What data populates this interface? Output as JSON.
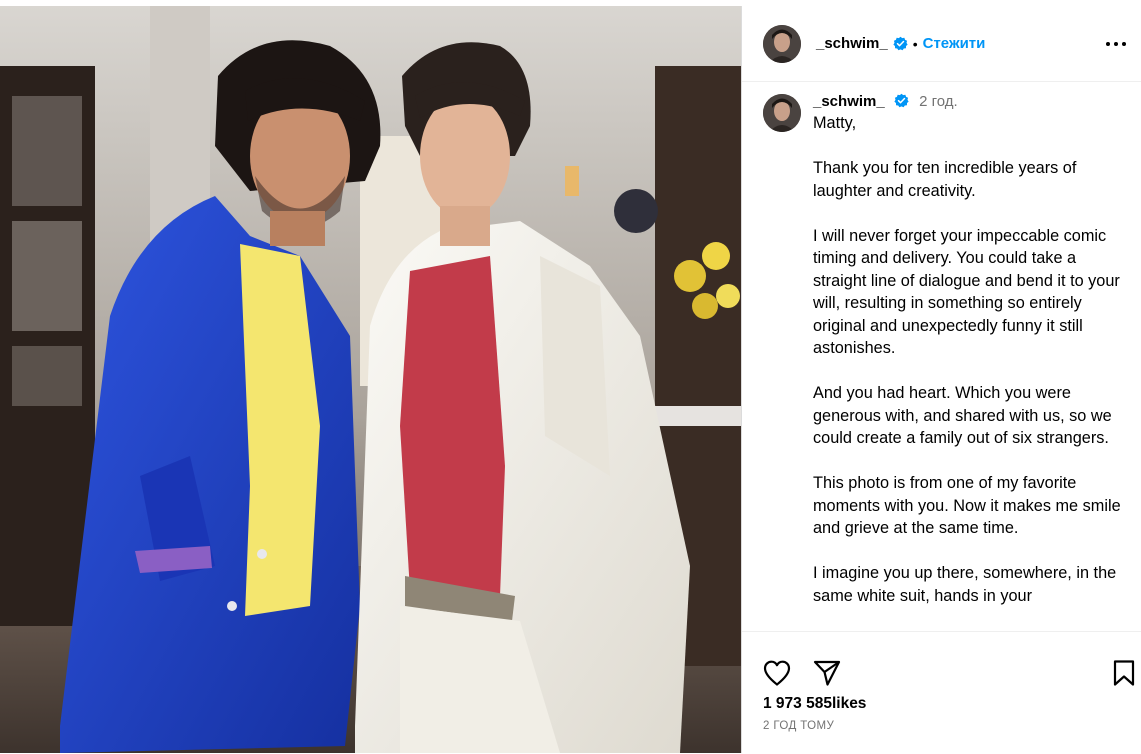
{
  "post": {
    "username": "_schwim_",
    "follow_label": "Стежити",
    "separator": "•",
    "time": "2 год.",
    "caption": "Matty,\n\nThank you for ten incredible years of laughter and creativity.\n\nI will never forget your impeccable comic timing and delivery. You could take a straight line of dialogue and bend it to your will, resulting in something so entirely original and unexpectedly funny it still astonishes.\n\nAnd you had heart. Which you were generous with, and shared with us, so we could create a family out of six strangers.\n\nThis photo is from one of my favorite moments with you. Now it makes me smile and grieve at the same time.\n\nI imagine you up there, somewhere, in the same white suit, hands in your",
    "likes": "1 973 585likes",
    "posted_ago": "2 ГОД ТОМУ"
  },
  "icons": {
    "verified": "verified-badge-icon",
    "more": "more-options-icon",
    "like": "heart-icon",
    "share": "send-icon",
    "save": "bookmark-icon"
  },
  "colors": {
    "accent": "#0095f6",
    "verified": "#0095f6",
    "muted": "#737373",
    "blue_suit": "#1f3fc0",
    "white_suit": "#f3f1ea",
    "red_shirt": "#c23b4a",
    "yellow_shirt": "#f3e36a"
  }
}
